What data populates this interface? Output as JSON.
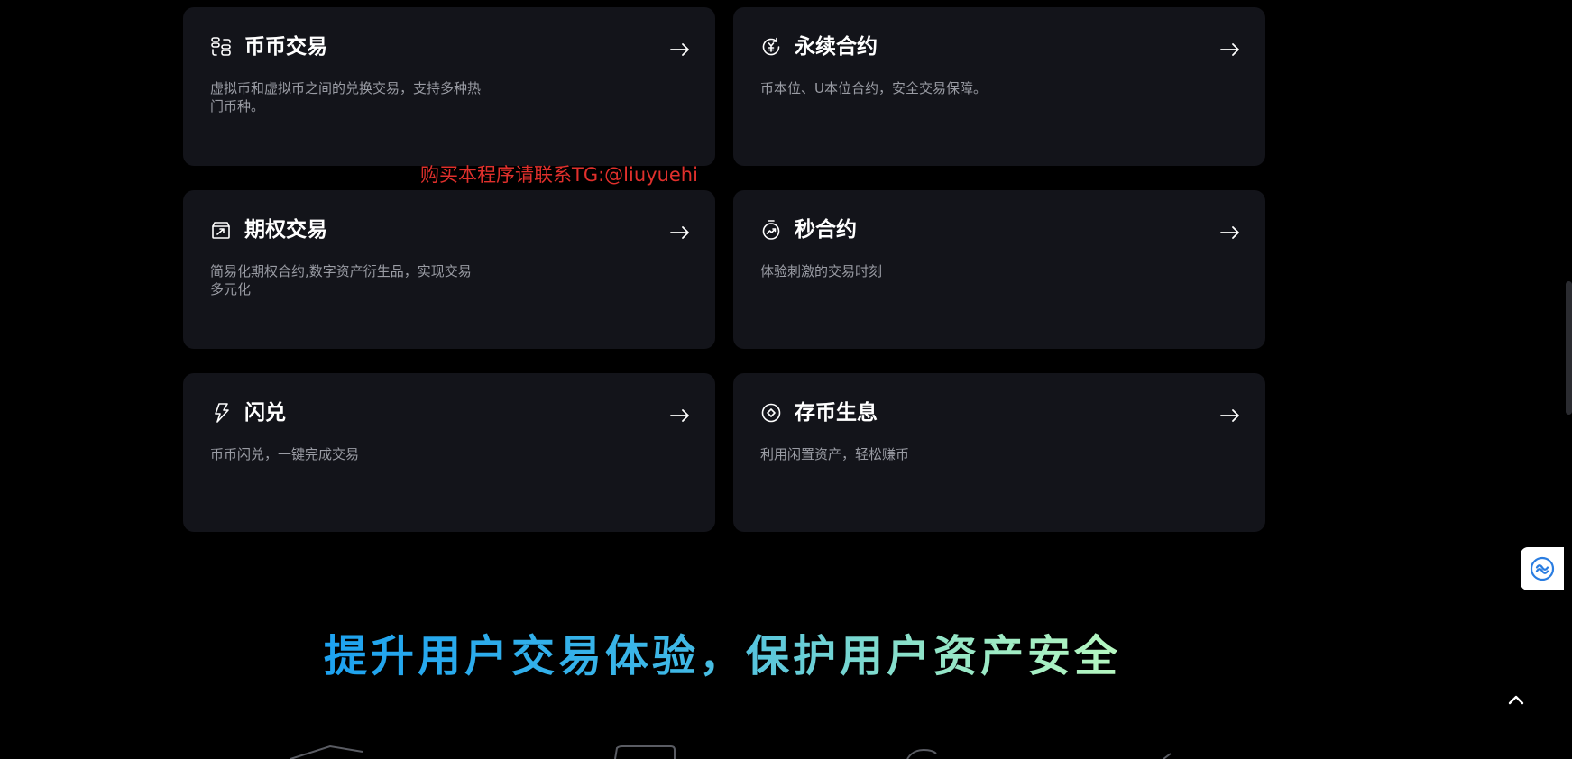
{
  "cards": [
    {
      "title": "币币交易",
      "desc": "虚拟币和虚拟币之间的兑换交易，支持多种热门币种。",
      "icon": "coins-stack-icon"
    },
    {
      "title": "永续合约",
      "desc": "币本位、U本位合约，安全交易保障。",
      "icon": "currency-cycle-icon"
    },
    {
      "title": "期权交易",
      "desc": "简易化期权合约,数字资产衍生品，实现交易多元化",
      "icon": "trend-box-icon"
    },
    {
      "title": "秒合约",
      "desc": "体验刺激的交易时刻",
      "icon": "stopwatch-icon"
    },
    {
      "title": "闪兑",
      "desc": "币币闪兑，一键完成交易",
      "icon": "lightning-icon"
    },
    {
      "title": "存币生息",
      "desc": "利用闲置资产，轻松赚币",
      "icon": "target-coin-icon"
    }
  ],
  "watermark": "购买本程序请联系TG:@liuyuehi",
  "headline": "提升用户交易体验，保护用户资产安全",
  "colors": {
    "background": "#000000",
    "card": "#13141a",
    "title": "#ffffff",
    "desc": "#9a9ca4",
    "watermark": "#e0302c",
    "gradient_start": "#1da2f0",
    "gradient_end": "#b6f7c0"
  }
}
